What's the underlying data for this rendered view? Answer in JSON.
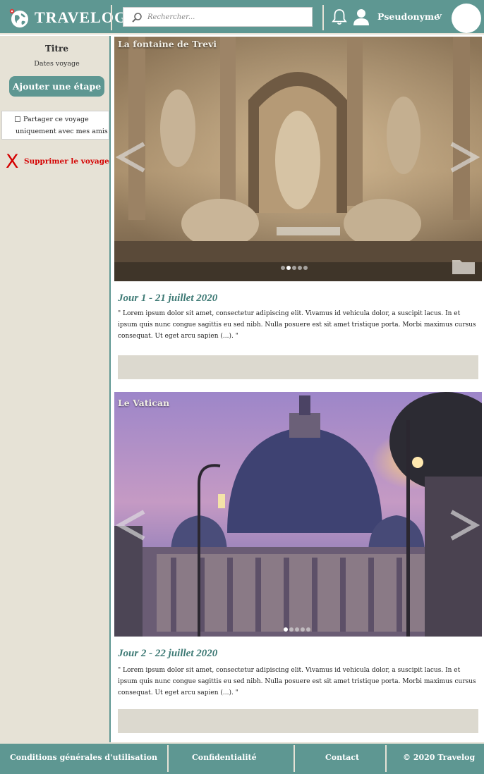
{
  "header": {
    "logo_text": "TRAVELOG",
    "search_placeholder": "Rechercher...",
    "username": "Pseudonyme",
    "dropdown_chevron": "v"
  },
  "sidebar": {
    "title": "Titre",
    "dates": "Dates voyage",
    "add_step_label": "Ajouter une étape",
    "share_label": "Partager ce voyage uniquement avec mes amis",
    "share_checked": false,
    "delete_icon": "X",
    "delete_label": "Supprimer le voyage"
  },
  "stages": [
    {
      "photo_title": "La fontaine de Trevi",
      "day_title": "Jour 1 - 21 juillet 2020",
      "text": "\" Lorem ipsum dolor sit amet, consectetur adipiscing elit. Vivamus id vehicula dolor, a suscipit lacus. In et ipsum quis nunc congue sagittis eu sed nibh. Nulla posuere est sit amet tristique porta. Morbi maximus cursus consequat. Ut eget arcu sapien (...). \"",
      "carousel_dot_count": 5,
      "carousel_active_dot": 1
    },
    {
      "photo_title": "Le Vatican",
      "day_title": "Jour 2 - 22 juillet 2020",
      "text": "\" Lorem ipsum dolor sit amet, consectetur adipiscing elit. Vivamus id vehicula dolor, a suscipit lacus. In et ipsum quis nunc congue sagittis eu sed nibh. Nulla posuere est sit amet tristique porta. Morbi maximus cursus consequat. Ut eget arcu sapien (...). \"",
      "carousel_dot_count": 5,
      "carousel_active_dot": 0
    }
  ],
  "footer": {
    "cgu": "Conditions générales d'utilisation",
    "privacy": "Confidentialité",
    "contact": "Contact",
    "copyright": "©  2020 Travelog"
  },
  "colors": {
    "brand": "#5e9792",
    "sidebar_bg": "#e6e2d6",
    "delete": "#d40000",
    "day_title": "#3e7a75"
  },
  "icons": {
    "logo": "globe-pin-icon",
    "search": "magnifier-icon",
    "notifications": "bell-icon",
    "user": "user-icon",
    "carousel_prev": "chevron-left-icon",
    "carousel_next": "chevron-right-icon",
    "folder": "folder-icon"
  }
}
